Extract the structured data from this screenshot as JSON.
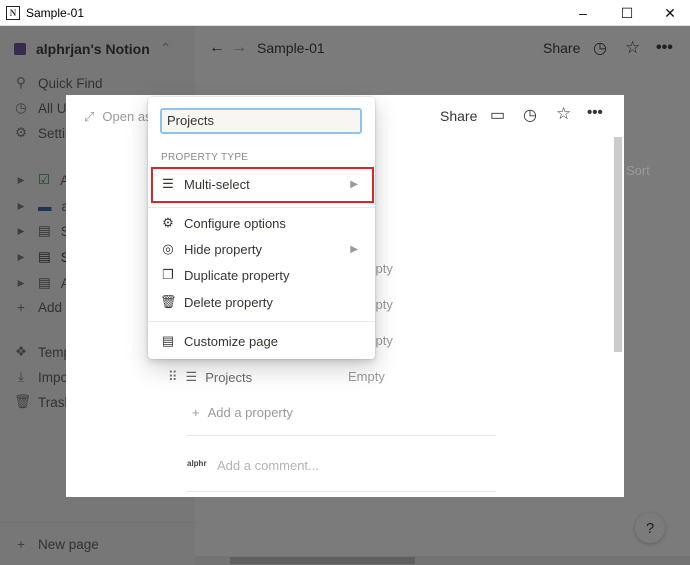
{
  "window": {
    "title": "Sample-01",
    "minimize": "–",
    "maximize": "☐",
    "close": "✕"
  },
  "sidebar": {
    "workspace": "alphrjan's Notion",
    "items": [
      {
        "label": "Quick Find",
        "icon": "search-icon",
        "glyph": "⚲"
      },
      {
        "label": "All Updates",
        "icon": "clock-icon",
        "glyph": "◷"
      },
      {
        "label": "Settings & Members",
        "icon": "gear-icon",
        "glyph": "⚙"
      }
    ],
    "pages": [
      {
        "label": "A",
        "glyph": "☑"
      },
      {
        "label": "al",
        "glyph": "▬"
      },
      {
        "label": "Sa",
        "glyph": "▤"
      },
      {
        "label": "Sa",
        "glyph": "▤"
      },
      {
        "label": "A",
        "glyph": "▤"
      }
    ],
    "add": "Add a page",
    "bottom": [
      {
        "label": "Templates",
        "glyph": "❖"
      },
      {
        "label": "Import",
        "glyph": "⤓"
      },
      {
        "label": "Trash",
        "glyph": "🗑"
      }
    ],
    "new_page": "New page"
  },
  "topbar": {
    "breadcrumb": "Sample-01",
    "share": "Share"
  },
  "modal": {
    "open_as": "Open as page",
    "share": "Share",
    "sort": "Sort",
    "empty": "Empty",
    "props": [
      "Empty",
      "Empty",
      "Empty"
    ],
    "projects_prop": "Projects",
    "add_property": "Add a property",
    "comment_avatar": "alphr",
    "comment_placeholder": "Add a comment..."
  },
  "menu": {
    "input_value": "Projects",
    "section": "PROPERTY TYPE",
    "type": "Multi-select",
    "items": [
      "Configure options",
      "Hide property",
      "Duplicate property",
      "Delete property"
    ],
    "customize": "Customize page"
  },
  "help": "?"
}
